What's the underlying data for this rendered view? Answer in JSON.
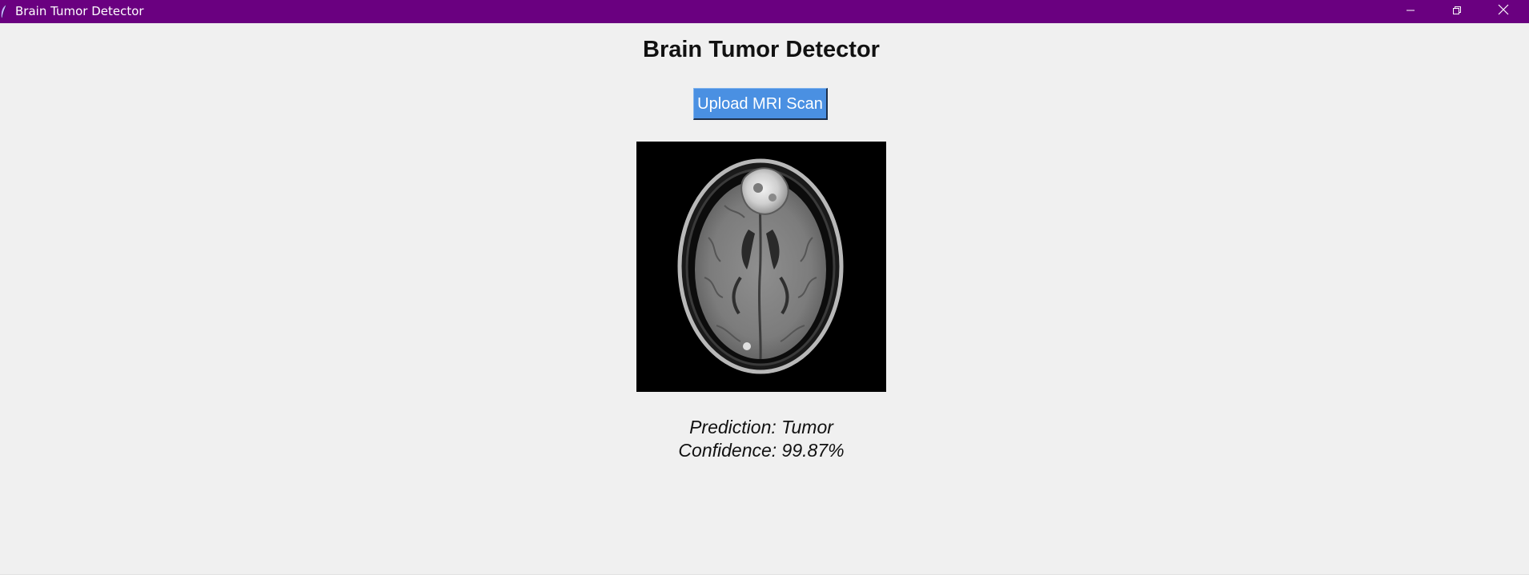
{
  "window": {
    "title": "Brain Tumor Detector",
    "app_icon": "feather-icon",
    "titlebar_color": "#6a0080",
    "controls": [
      "minimize-icon",
      "restore-icon",
      "close-icon"
    ]
  },
  "main": {
    "heading": "Brain Tumor Detector",
    "upload_button_label": "Upload MRI Scan",
    "upload_button_color": "#4a90e2",
    "image": "brain-mri-scan",
    "prediction_text": "Prediction: Tumor",
    "confidence_text": "Confidence: 99.87%"
  }
}
